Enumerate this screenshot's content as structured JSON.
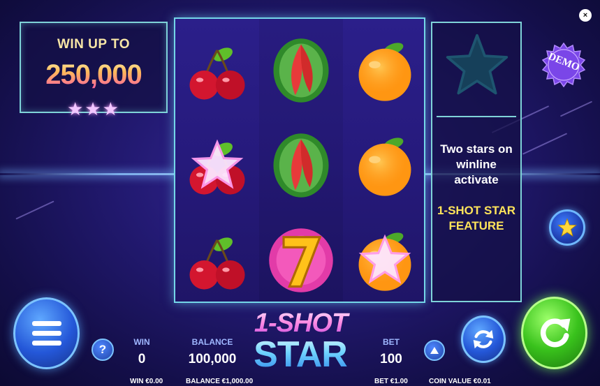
{
  "win_panel": {
    "title": "WIN UP TO",
    "amount": "250,000",
    "stars": "★★★"
  },
  "reels": [
    [
      "cherry",
      "cherry-star",
      "cherry"
    ],
    [
      "watermelon",
      "watermelon",
      "seven"
    ],
    [
      "orange",
      "orange",
      "orange-star"
    ]
  ],
  "feature_panel": {
    "line1": "Two stars on",
    "line2": "winline",
    "line3": "activate",
    "line4": "1-SHOT STAR",
    "line5": "FEATURE",
    "icon": "star-icon"
  },
  "demo_badge": "DEMO",
  "close_label": "×",
  "help_label": "?",
  "stats": {
    "win": {
      "label": "WIN",
      "value": "0"
    },
    "balance": {
      "label": "BALANCE",
      "value": "100,000"
    },
    "bet": {
      "label": "BET",
      "value": "100"
    }
  },
  "footer": {
    "win": "WIN €0.00",
    "balance": "BALANCE €1,000.00",
    "bet": "BET €1.00",
    "coin_value": "COIN VALUE €0.01"
  },
  "logo": {
    "line1": "1-SHOT",
    "line2": "STAR"
  },
  "colors": {
    "panel_border": "#7fd3d8",
    "accent_yellow": "#ffe45a",
    "spin_green": "#39c21c",
    "button_blue": "#2457d8"
  }
}
